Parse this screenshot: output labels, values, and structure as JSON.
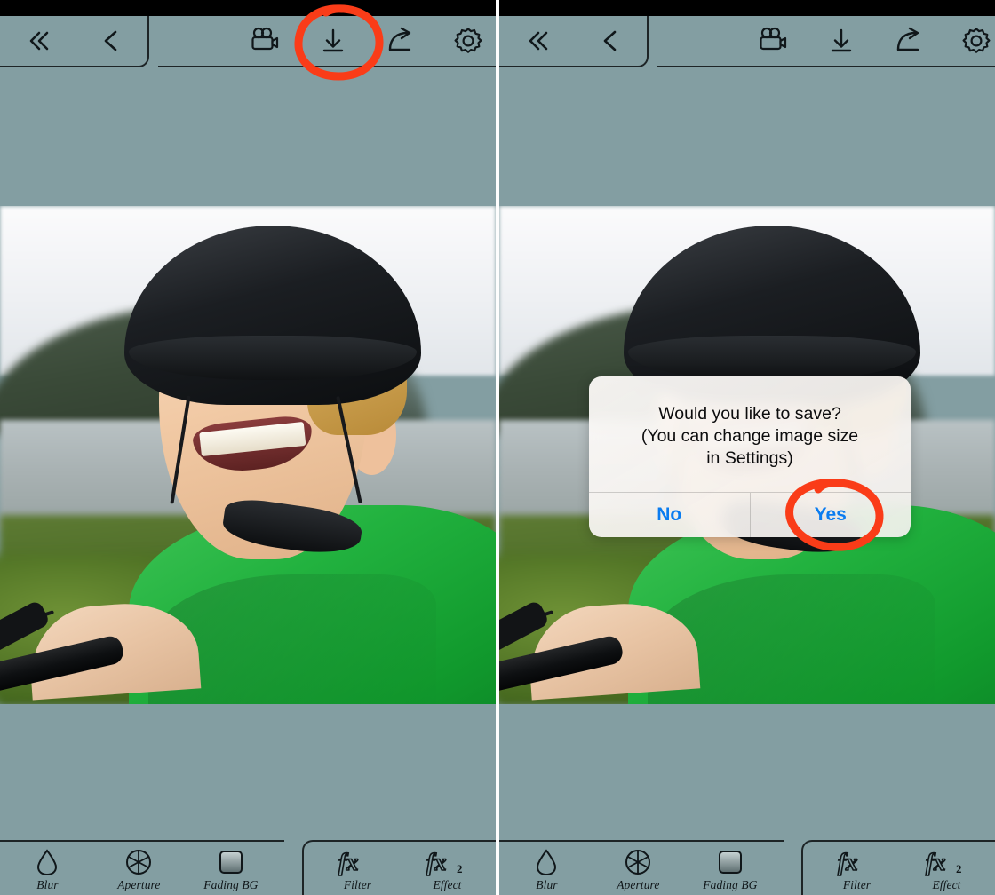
{
  "app": {
    "background_color": "#839ea2",
    "annotation_color": "#fa3c18",
    "accent_color": "#0a7cf0"
  },
  "toolbar": {
    "nav": [
      {
        "name": "back-all-button",
        "icon": "double-chevron-left-icon",
        "label": "Back to start"
      },
      {
        "name": "back-button",
        "icon": "chevron-left-icon",
        "label": "Back"
      }
    ],
    "actions": [
      {
        "name": "video-button",
        "icon": "video-camera-icon",
        "label": "Video"
      },
      {
        "name": "save-button",
        "icon": "download-arrow-icon",
        "label": "Save"
      },
      {
        "name": "share-button",
        "icon": "share-arrow-icon",
        "label": "Share"
      },
      {
        "name": "settings-button",
        "icon": "gear-icon",
        "label": "Settings"
      }
    ]
  },
  "bottom_toolbar": {
    "left_tools": [
      {
        "name": "blur-tool",
        "icon": "droplet-icon",
        "label": "Blur"
      },
      {
        "name": "aperture-tool",
        "icon": "aperture-icon",
        "label": "Aperture"
      },
      {
        "name": "fading-bg-tool",
        "icon": "square-gradient-icon",
        "label": "Fading BG"
      }
    ],
    "right_tools": [
      {
        "name": "filter-tool",
        "icon": "fx-icon",
        "label": "Filter"
      },
      {
        "name": "effect-tool",
        "icon": "fx2-icon",
        "label": "Effect"
      }
    ]
  },
  "dialog": {
    "message": "Would you like to save?\n(You can change image size\nin Settings)",
    "buttons": [
      {
        "name": "dialog-no-button",
        "label": "No"
      },
      {
        "name": "dialog-yes-button",
        "label": "Yes"
      }
    ]
  },
  "photo": {
    "description": "Boy in bicycle helmet and green shirt smiling by a lake"
  },
  "panels": [
    {
      "name": "left-panel",
      "annotation_target": "save-button",
      "dialog_visible": false
    },
    {
      "name": "right-panel",
      "annotation_target": "dialog-yes-button",
      "dialog_visible": true
    }
  ]
}
